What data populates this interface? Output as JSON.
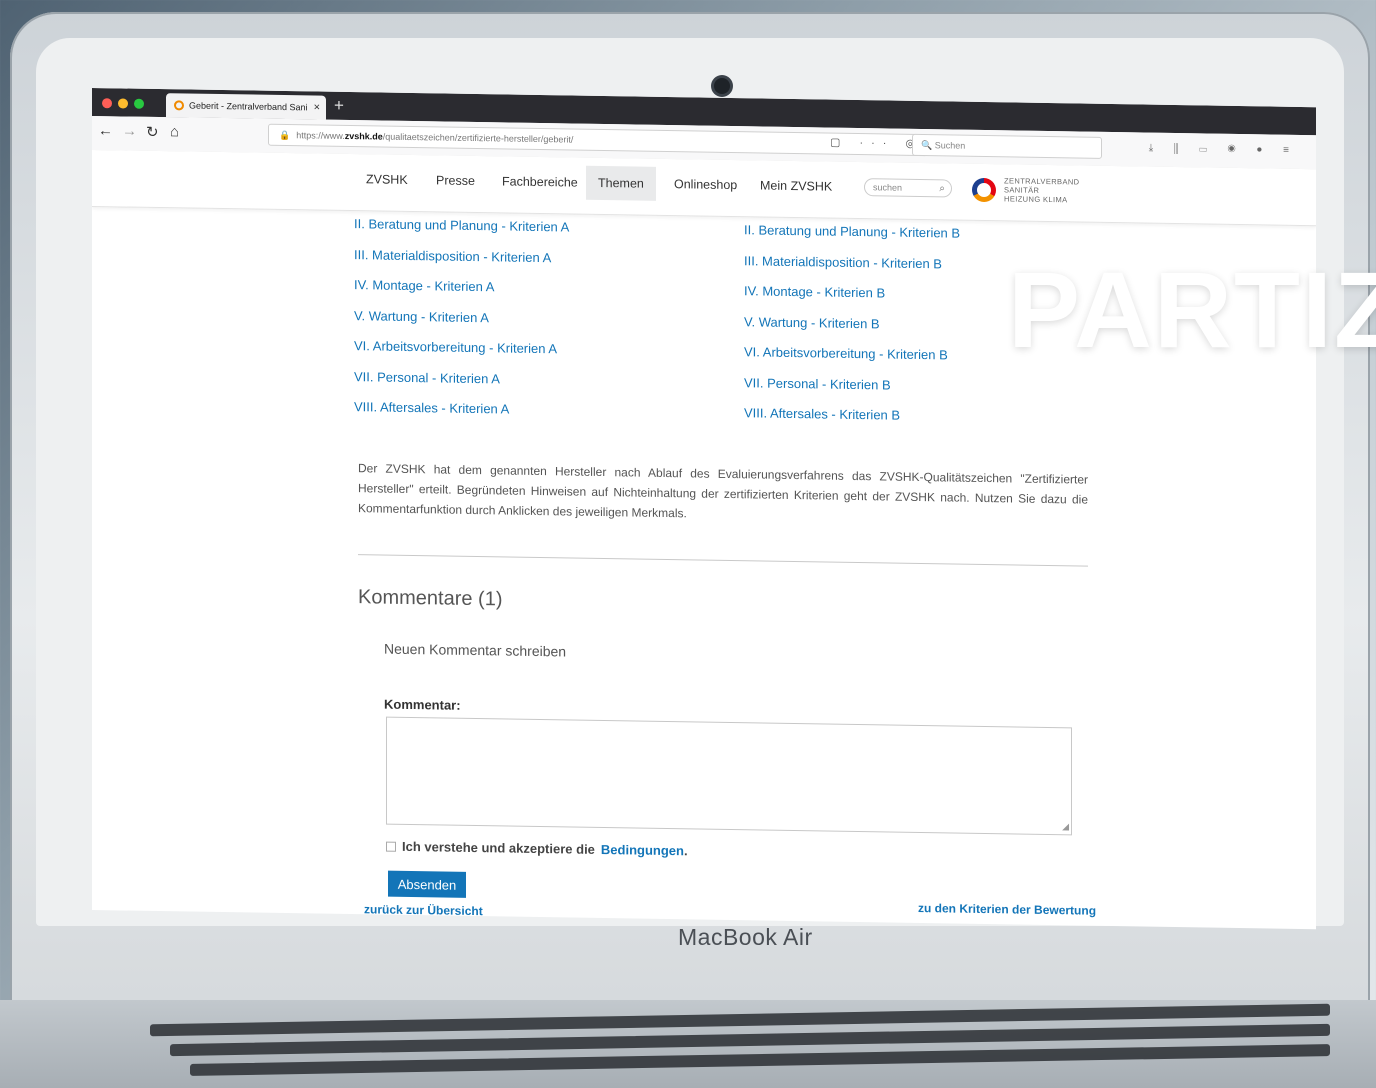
{
  "browser": {
    "tab_title": "Geberit - Zentralverband Sani",
    "tab_close": "×",
    "new_tab": "+",
    "url_prefix": "https://www.",
    "url_domain": "zvshk.de",
    "url_path": "/qualitaetszeichen/zertifizierte-hersteller/geberit/",
    "search_placeholder": "Suchen",
    "nav_back": "←",
    "nav_forward": "→",
    "nav_reload": "↻",
    "nav_home": "⌂",
    "url_icons": "▢ ··· ◎ ☆",
    "toolbar_icons": "⤓ ⫼ ▭ ◉ ● ≡"
  },
  "site": {
    "nav": [
      "ZVSHK",
      "Presse",
      "Fachbereiche",
      "Themen",
      "Onlineshop",
      "Mein ZVSHK"
    ],
    "active_nav": "Themen",
    "search_placeholder": "suchen",
    "logo_lines": [
      "ZENTRALVERBAND",
      "SANITÄR",
      "HEIZUNG KLIMA"
    ]
  },
  "criteria_a": [
    "II. Beratung und Planung - Kriterien A",
    "III. Materialdisposition - Kriterien A",
    "IV. Montage - Kriterien A",
    "V. Wartung - Kriterien A",
    "VI. Arbeitsvorbereitung - Kriterien A",
    "VII. Personal - Kriterien A",
    "VIII. Aftersales - Kriterien A"
  ],
  "criteria_b": [
    "II. Beratung und Planung - Kriterien B",
    "III. Materialdisposition - Kriterien B",
    "IV. Montage - Kriterien B",
    "V. Wartung - Kriterien B",
    "VI. Arbeitsvorbereitung - Kriterien B",
    "VII. Personal - Kriterien B",
    "VIII. Aftersales - Kriterien B"
  ],
  "body_text": "Der ZVSHK hat dem genannten Hersteller nach Ablauf des Evaluierungsverfahrens das ZVSHK-Qualitätszeichen \"Zertifizierter Hersteller\" erteilt. Begründeten Hinweisen auf Nichteinhaltung der zertifizierten Kriterien geht der ZVSHK nach. Nutzen Sie dazu die Kommentarfunktion durch Anklicken des jeweiligen Merkmals.",
  "comments": {
    "heading": "Kommentare (1)",
    "new_comment": "Neuen Kommentar schreiben",
    "label": "Kommentar:",
    "terms_text": "Ich verstehe und akzeptiere die",
    "terms_link": "Bedingungen",
    "terms_end": ".",
    "submit": "Absenden",
    "footer_left": "zurück zur Übersicht",
    "footer_right": "zu den Kriterien der Bewertung"
  },
  "device_label": "MacBook Air",
  "overlay_text": "PARTIZ",
  "colors": {
    "link": "#1375b8",
    "button": "#1375b8"
  }
}
